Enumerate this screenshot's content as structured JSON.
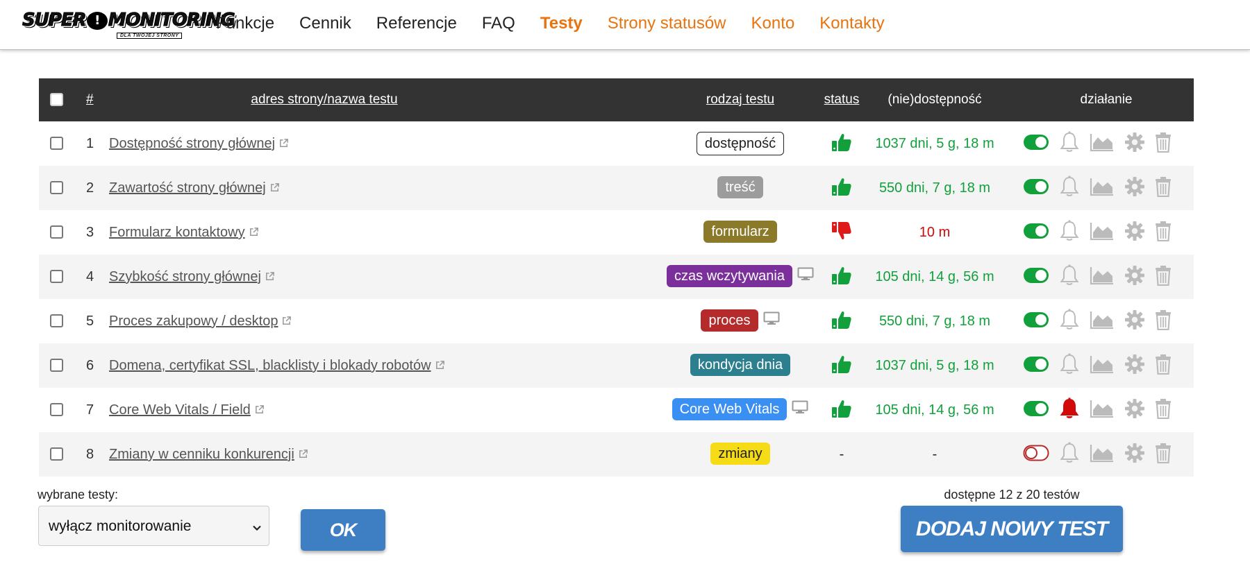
{
  "header": {
    "logo_text_left": "SUPER",
    "logo_bang": "!",
    "logo_text_right": "MONITORING",
    "logo_sub": "DLA TWOJEJ STRONY",
    "nav": [
      "Funkcje",
      "Cennik",
      "Referencje",
      "FAQ",
      "Testy",
      "Strony statusów",
      "Konto",
      "Kontakty"
    ],
    "active_nav": "Testy"
  },
  "table": {
    "headers": {
      "num": "#",
      "name": "adres strony/nazwa testu",
      "type": "rodzaj testu",
      "status": "status",
      "availability": "(nie)dostępność",
      "actions": "działanie"
    },
    "rows": [
      {
        "num": "1",
        "name": "Dostępność strony głównej",
        "type": "dostępność",
        "type_style": "outline",
        "device": "",
        "status": "up",
        "availability": "1037 dni, 5 g, 18 m",
        "avail_color": "green",
        "enabled": true,
        "alert_active": false
      },
      {
        "num": "2",
        "name": "Zawartość strony głównej",
        "type": "treść",
        "type_style": "gray",
        "device": "",
        "status": "up",
        "availability": "550 dni, 7 g, 18 m",
        "avail_color": "green",
        "enabled": true,
        "alert_active": false
      },
      {
        "num": "3",
        "name": "Formularz kontaktowy",
        "type": "formularz",
        "type_style": "olive",
        "device": "",
        "status": "down",
        "availability": "10 m",
        "avail_color": "red",
        "enabled": true,
        "alert_active": false
      },
      {
        "num": "4",
        "name": "Szybkość strony głównej",
        "type": "czas wczytywania",
        "type_style": "purple",
        "device": "monitor-icon",
        "status": "up",
        "availability": "105 dni, 14 g, 56 m",
        "avail_color": "green",
        "enabled": true,
        "alert_active": false
      },
      {
        "num": "5",
        "name": "Proces zakupowy / desktop",
        "type": "proces",
        "type_style": "darkred",
        "device": "monitor-icon",
        "status": "up",
        "availability": "550 dni, 7 g, 18 m",
        "avail_color": "green",
        "enabled": true,
        "alert_active": false
      },
      {
        "num": "6",
        "name": "Domena, certyfikat SSL, blacklisty i blokady robotów",
        "type": "kondycja dnia",
        "type_style": "teal",
        "device": "",
        "status": "up",
        "availability": "1037 dni, 5 g, 18 m",
        "avail_color": "green",
        "enabled": true,
        "alert_active": false
      },
      {
        "num": "7",
        "name": "Core Web Vitals / Field",
        "type": "Core Web Vitals",
        "type_style": "blue",
        "device": "monitor-icon",
        "status": "up",
        "availability": "105 dni, 14 g, 56 m",
        "avail_color": "green",
        "enabled": true,
        "alert_active": true
      },
      {
        "num": "8",
        "name": "Zmiany w cenniku konkurencji",
        "type": "zmiany",
        "type_style": "yellow",
        "device": "",
        "status": "-",
        "availability": "-",
        "avail_color": "dash",
        "enabled": false,
        "alert_active": false
      }
    ]
  },
  "bulk": {
    "label": "wybrane testy:",
    "selected": "wyłącz monitorowanie",
    "ok": "OK"
  },
  "quota": {
    "text": "dostępne 12 z 20 testów",
    "add_button": "DODAJ NOWY TEST"
  },
  "colors": {
    "accent_orange": "#e9730f",
    "header_dark": "#333333",
    "green": "#11a03c",
    "red": "#d20a0a",
    "button_blue": "#3e7fc4"
  }
}
